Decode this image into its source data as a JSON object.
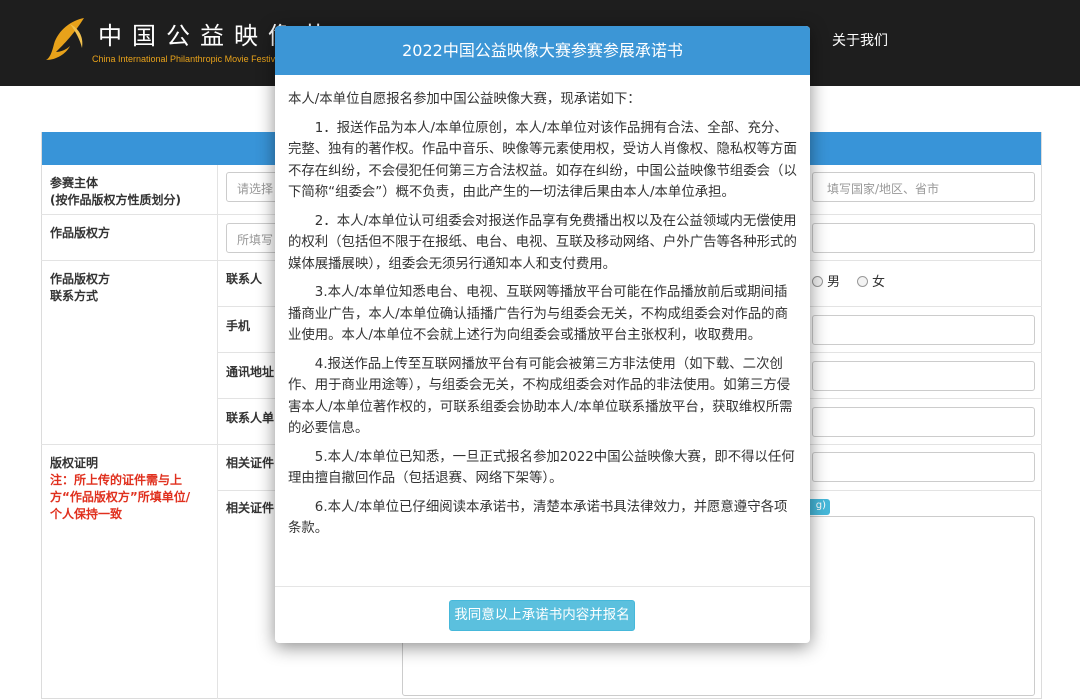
{
  "header": {
    "logo_cn": "中国公益映像节",
    "logo_en": "China International Philanthropic Movie Festival",
    "nav_about": "关于我们"
  },
  "form": {
    "subject_label_1": "参赛主体",
    "subject_label_2": "(按作品版权方性质划分)",
    "subject_select_placeholder": "请选择",
    "region_placeholder": "填写国家/地区、省市",
    "owner_label": "作品版权方",
    "owner_placeholder": "所填写",
    "contact_label_1": "作品版权方",
    "contact_label_2": "联系方式",
    "contact_person_label": "联系人",
    "gender_male": "男",
    "gender_female": "女",
    "phone_label": "手机",
    "address_label": "通讯地址",
    "contact_unit_label": "联系人单",
    "proof_label": "版权证明",
    "proof_note_1": "注：所上传的证件需与上",
    "proof_note_2": "方“作品版权方”所填单位/",
    "proof_note_3": "个人保持一致",
    "cert_label_1": "相关证件",
    "cert_label_2": "相关证件",
    "badge_text": "g)"
  },
  "modal": {
    "title": "2022中国公益映像大赛参赛参展承诺书",
    "intro": "本人/本单位自愿报名参加中国公益映像大赛，现承诺如下：",
    "clauses": [
      "1．报送作品为本人/本单位原创，本人/本单位对该作品拥有合法、全部、充分、完整、独有的著作权。作品中音乐、映像等元素使用权，受访人肖像权、隐私权等方面不存在纠纷，不会侵犯任何第三方合法权益。如存在纠纷，中国公益映像节组委会（以下简称“组委会”）概不负责，由此产生的一切法律后果由本人/本单位承担。",
      "2．本人/本单位认可组委会对报送作品享有免费播出权以及在公益领域内无偿使用的权利（包括但不限于在报纸、电台、电视、互联及移动网络、户外广告等各种形式的媒体展播展映），组委会无须另行通知本人和支付费用。",
      "3.本人/本单位知悉电台、电视、互联网等播放平台可能在作品播放前后或期间插播商业广告，本人/本单位确认插播广告行为与组委会无关，不构成组委会对作品的商业使用。本人/本单位不会就上述行为向组委会或播放平台主张权利，收取费用。",
      "4.报送作品上传至互联网播放平台有可能会被第三方非法使用（如下载、二次创作、用于商业用途等），与组委会无关，不构成组委会对作品的非法使用。如第三方侵害本人/本单位著作权的，可联系组委会协助本人/本单位联系播放平台，获取维权所需的必要信息。",
      "5.本人/本单位已知悉，一旦正式报名参加2022中国公益映像大赛，即不得以任何理由擅自撤回作品（包括退赛、网络下架等）。",
      "6.本人/本单位已仔细阅读本承诺书，清楚本承诺书具法律效力，并愿意遵守各项条款。"
    ],
    "agree_button": "我同意以上承诺书内容并报名"
  }
}
